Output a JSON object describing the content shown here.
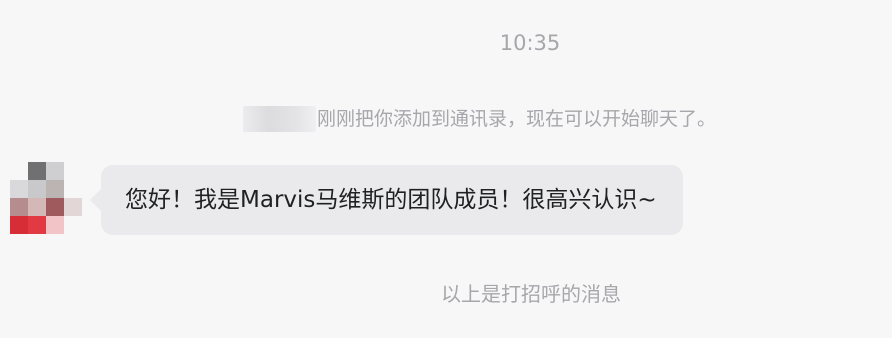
{
  "chat": {
    "timestamp": "10:35",
    "system_message": "刚刚把你添加到通讯录，现在可以开始聊天了。",
    "message_text": "您好！我是Marvis马维斯的团队成员！很高兴认识~",
    "footer_note": "以上是打招呼的消息"
  },
  "colors": {
    "background": "#f7f7f8",
    "bubble": "#eaeaec",
    "muted_text": "#a7a7ab",
    "message_text": "#202124",
    "avatar_pixels": [
      "#f7f7f8",
      "#707073",
      "#cfcfd2",
      "#f7f7f8",
      "#d9d8da",
      "#c9c8ca",
      "#bcb4b3",
      "#f7f7f8",
      "#b68d8f",
      "#d4b8b7",
      "#9e5a5d",
      "#e2d6d7",
      "#d72d36",
      "#e23a42",
      "#f2c4c7",
      "#f7f7f8"
    ]
  }
}
